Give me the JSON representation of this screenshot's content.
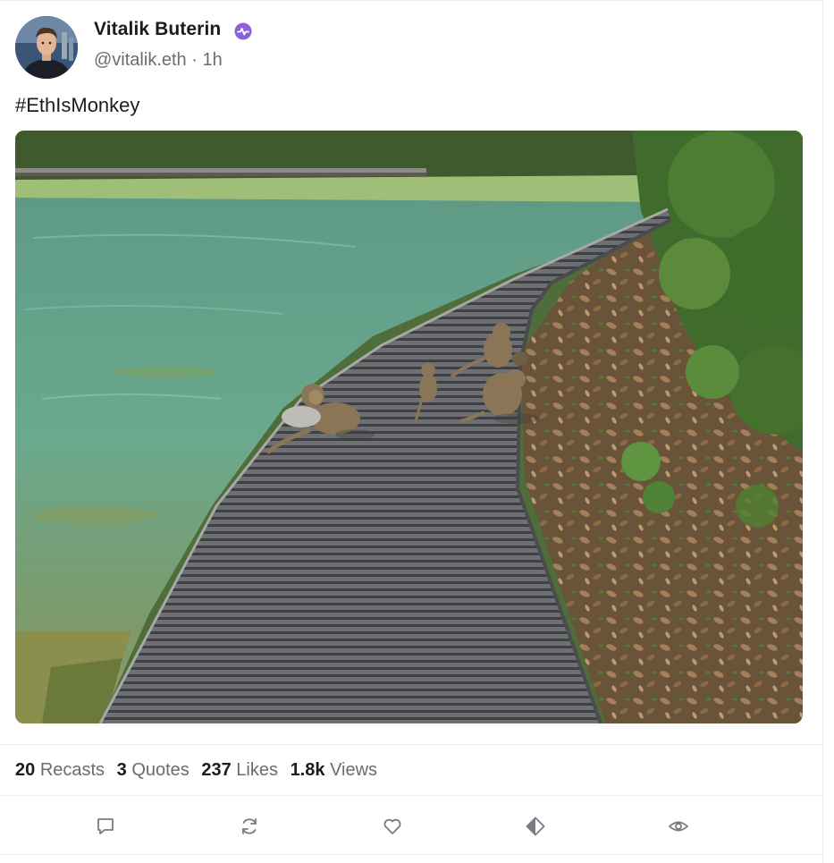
{
  "post": {
    "author_name": "Vitalik Buterin",
    "handle": "@vitalik.eth",
    "separator": "·",
    "time": "1h",
    "text": "#EthIsMonkey",
    "verified_icon": "power-badge-icon",
    "accent_color": "#8a63d2"
  },
  "stats": [
    {
      "count": "20",
      "label": "Recasts"
    },
    {
      "count": "3",
      "label": "Quotes"
    },
    {
      "count": "237",
      "label": "Likes"
    },
    {
      "count": "1.8k",
      "label": "Views"
    }
  ],
  "actions": [
    {
      "icon": "reply-icon"
    },
    {
      "icon": "recast-icon"
    },
    {
      "icon": "heart-icon"
    },
    {
      "icon": "mint-icon"
    },
    {
      "icon": "eye-icon"
    }
  ]
}
